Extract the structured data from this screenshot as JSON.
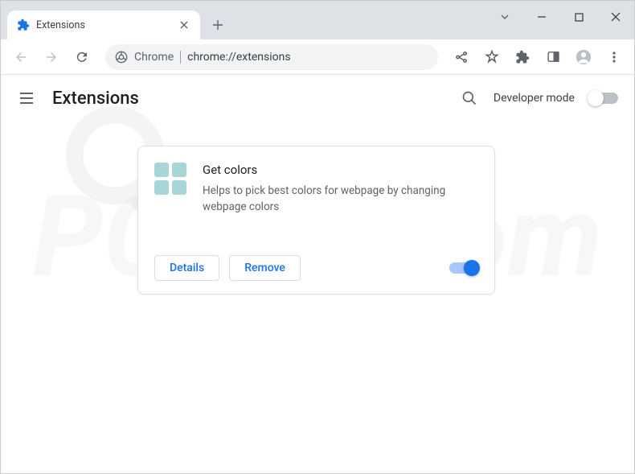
{
  "window": {
    "tab_title": "Extensions"
  },
  "omnibox": {
    "scheme_label": "Chrome",
    "url": "chrome://extensions"
  },
  "header": {
    "title": "Extensions",
    "dev_mode_label": "Developer mode",
    "dev_mode_on": false
  },
  "extension": {
    "name": "Get colors",
    "description": "Helps to pick best colors for webpage by changing webpage colors",
    "details_label": "Details",
    "remove_label": "Remove",
    "enabled": true
  }
}
